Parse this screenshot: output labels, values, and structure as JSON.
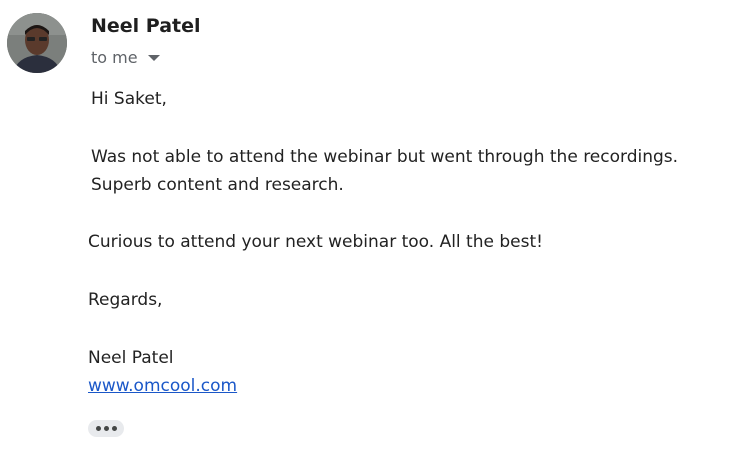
{
  "email": {
    "sender_name": "Neel Patel",
    "recipient_label": "to me",
    "body": {
      "greeting": "Hi Saket,",
      "paragraph1_line1": "Was not able to attend the webinar but went through the recordings.",
      "paragraph1_line2": "Superb content and research.",
      "paragraph2": "Curious to attend your next webinar too. All the best!",
      "signoff": "Regards,",
      "signature_name": "Neel Patel",
      "signature_link": "www.omcool.com"
    }
  },
  "icons": {
    "recipient_details": "chevron-down-icon",
    "show_trimmed": "more-horizontal-icon"
  },
  "colors": {
    "link": "#1a57c8",
    "muted_text": "#5f6368",
    "body_text": "#222222",
    "trim_button_bg": "#e8eaed"
  }
}
